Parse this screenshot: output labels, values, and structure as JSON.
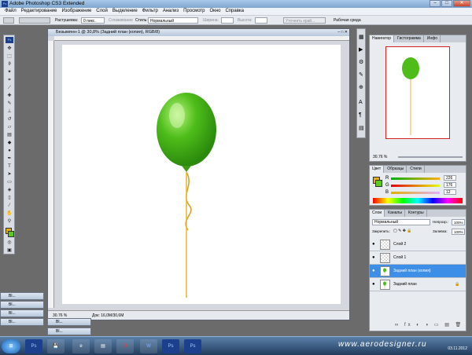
{
  "window": {
    "title": "Adobe Photoshop CS3 Extended",
    "app_icon": "Ps"
  },
  "menu": [
    "Файл",
    "Редактирование",
    "Изображение",
    "Слой",
    "Выделение",
    "Фильтр",
    "Анализ",
    "Просмотр",
    "Окно",
    "Справка"
  ],
  "options": {
    "feather_label": "Растушевка:",
    "feather_value": "0 пикс.",
    "antialias_label": "Сглаживание",
    "style_label": "Стиль:",
    "style_value": "Нормальный",
    "width_label": "Ширина:",
    "height_label": "Высота:",
    "refine_label": "Уточнить край...",
    "workspace_label": "Рабочая среда"
  },
  "document": {
    "title": "Безымянн-1 @ 30,8% (Задний план (копия), RGB/8)",
    "zoom": "30.76 %",
    "doc_size": "Док: 16,0M/30,6M"
  },
  "navigator": {
    "tabs": [
      "Навигатор",
      "Гистограмма",
      "Инфо"
    ],
    "zoom": "30.76 %"
  },
  "color_panel": {
    "tabs": [
      "Цвет",
      "Образцы",
      "Стили"
    ],
    "channels": [
      {
        "label": "R",
        "value": "226"
      },
      {
        "label": "G",
        "value": "176"
      },
      {
        "label": "B",
        "value": "12"
      }
    ],
    "foreground": "#e2b00c",
    "background": "#5fc81e"
  },
  "layers_panel": {
    "tabs": [
      "Слои",
      "Каналы",
      "Контуры"
    ],
    "blend_mode": "Нормальный",
    "opacity_label": "Непрозр.:",
    "opacity_value": "100%",
    "lock_label": "Закрепить:",
    "fill_label": "Заливка:",
    "fill_value": "100%",
    "layers": [
      {
        "name": "Слой 2",
        "selected": false
      },
      {
        "name": "Слой 1",
        "selected": false
      },
      {
        "name": "Задний план (копия)",
        "selected": true
      },
      {
        "name": "Задний план",
        "selected": false
      }
    ]
  },
  "minimized_docs": [
    "Bl...",
    "Bl...",
    "Bl...",
    "Bl...",
    "Bl...",
    "Bl..."
  ],
  "taskbar": {
    "apps": [
      "start",
      "Ps",
      "save",
      "ie",
      "doc",
      "opera",
      "word",
      "ps2",
      "ps3"
    ],
    "watermark": "www.aerodesigner.ru",
    "time": "",
    "date": "03.11.2012"
  }
}
